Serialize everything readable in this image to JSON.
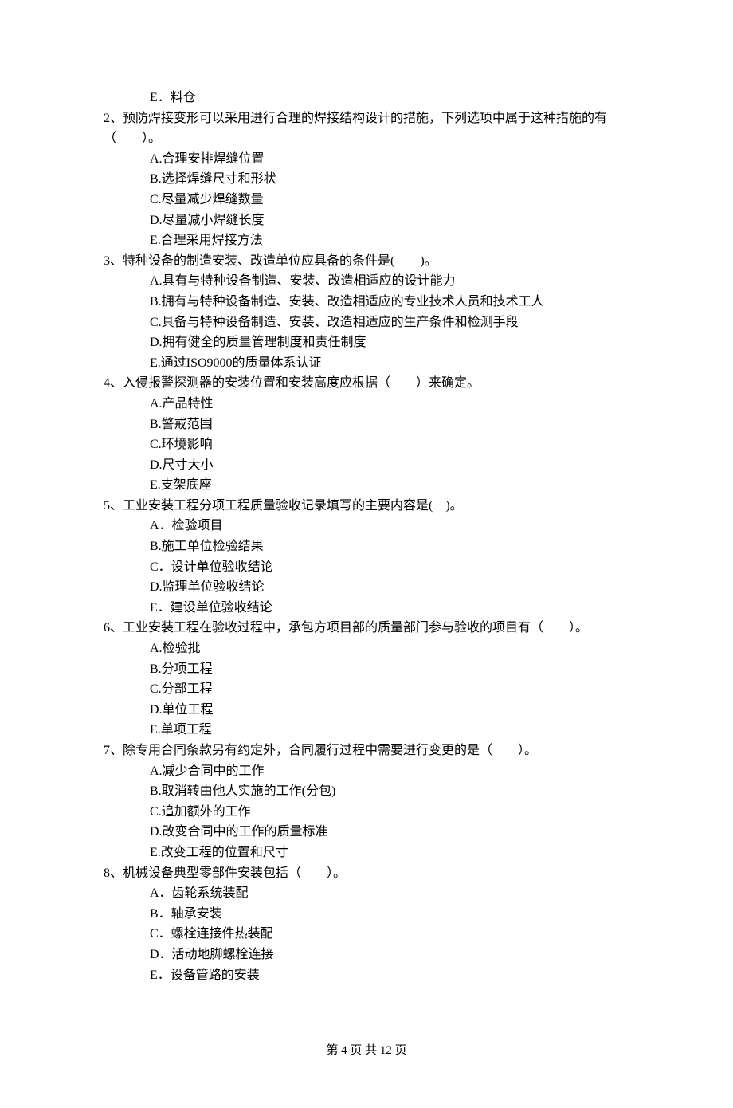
{
  "q1_remainder": {
    "options": [
      "E．料仓"
    ]
  },
  "questions": [
    {
      "num": "2、",
      "text": "预防焊接变形可以采用进行合理的焊接结构设计的措施，下列选项中属于这种措施的有（　　）。",
      "options": [
        "A.合理安排焊缝位置",
        "B.选择焊缝尺寸和形状",
        "C.尽量减少焊缝数量",
        "D.尽量减小焊缝长度",
        "E.合理采用焊接方法"
      ]
    },
    {
      "num": "3、",
      "text": "特种设备的制造安装、改造单位应具备的条件是(　　)。",
      "options": [
        "A.具有与特种设备制造、安装、改造相适应的设计能力",
        "B.拥有与特种设备制造、安装、改造相适应的专业技术人员和技术工人",
        "C.具备与特种设备制造、安装、改造相适应的生产条件和检测手段",
        "D.拥有健全的质量管理制度和责任制度",
        "E.通过ISO9000的质量体系认证"
      ]
    },
    {
      "num": "4、",
      "text": "入侵报警探测器的安装位置和安装高度应根据（　　）来确定。",
      "options": [
        "A.产品特性",
        "B.警戒范围",
        "C.环境影响",
        "D.尺寸大小",
        "E.支架底座"
      ]
    },
    {
      "num": "5、",
      "text": "工业安装工程分项工程质量验收记录填写的主要内容是(　)。",
      "options": [
        "A．检验项目",
        "B.施工单位检验结果",
        "C．设计单位验收结论",
        "D.监理单位验收结论",
        "E．建设单位验收结论"
      ]
    },
    {
      "num": "6、",
      "text": "工业安装工程在验收过程中，承包方项目部的质量部门参与验收的项目有（　　）。",
      "options": [
        "A.检验批",
        "B.分项工程",
        "C.分部工程",
        "D.单位工程",
        "E.单项工程"
      ]
    },
    {
      "num": "7、",
      "text": "除专用合同条款另有约定外，合同履行过程中需要进行变更的是（　　）。",
      "options": [
        "A.减少合同中的工作",
        "B.取消转由他人实施的工作(分包)",
        "C.追加额外的工作",
        "D.改变合同中的工作的质量标准",
        "E.改变工程的位置和尺寸"
      ]
    },
    {
      "num": "8、",
      "text": "机械设备典型零部件安装包括（　　）。",
      "options": [
        "A．齿轮系统装配",
        "B．轴承安装",
        "C．螺栓连接件热装配",
        "D．活动地脚螺栓连接",
        "E．设备管路的安装"
      ]
    }
  ],
  "footer": "第 4 页 共 12 页"
}
